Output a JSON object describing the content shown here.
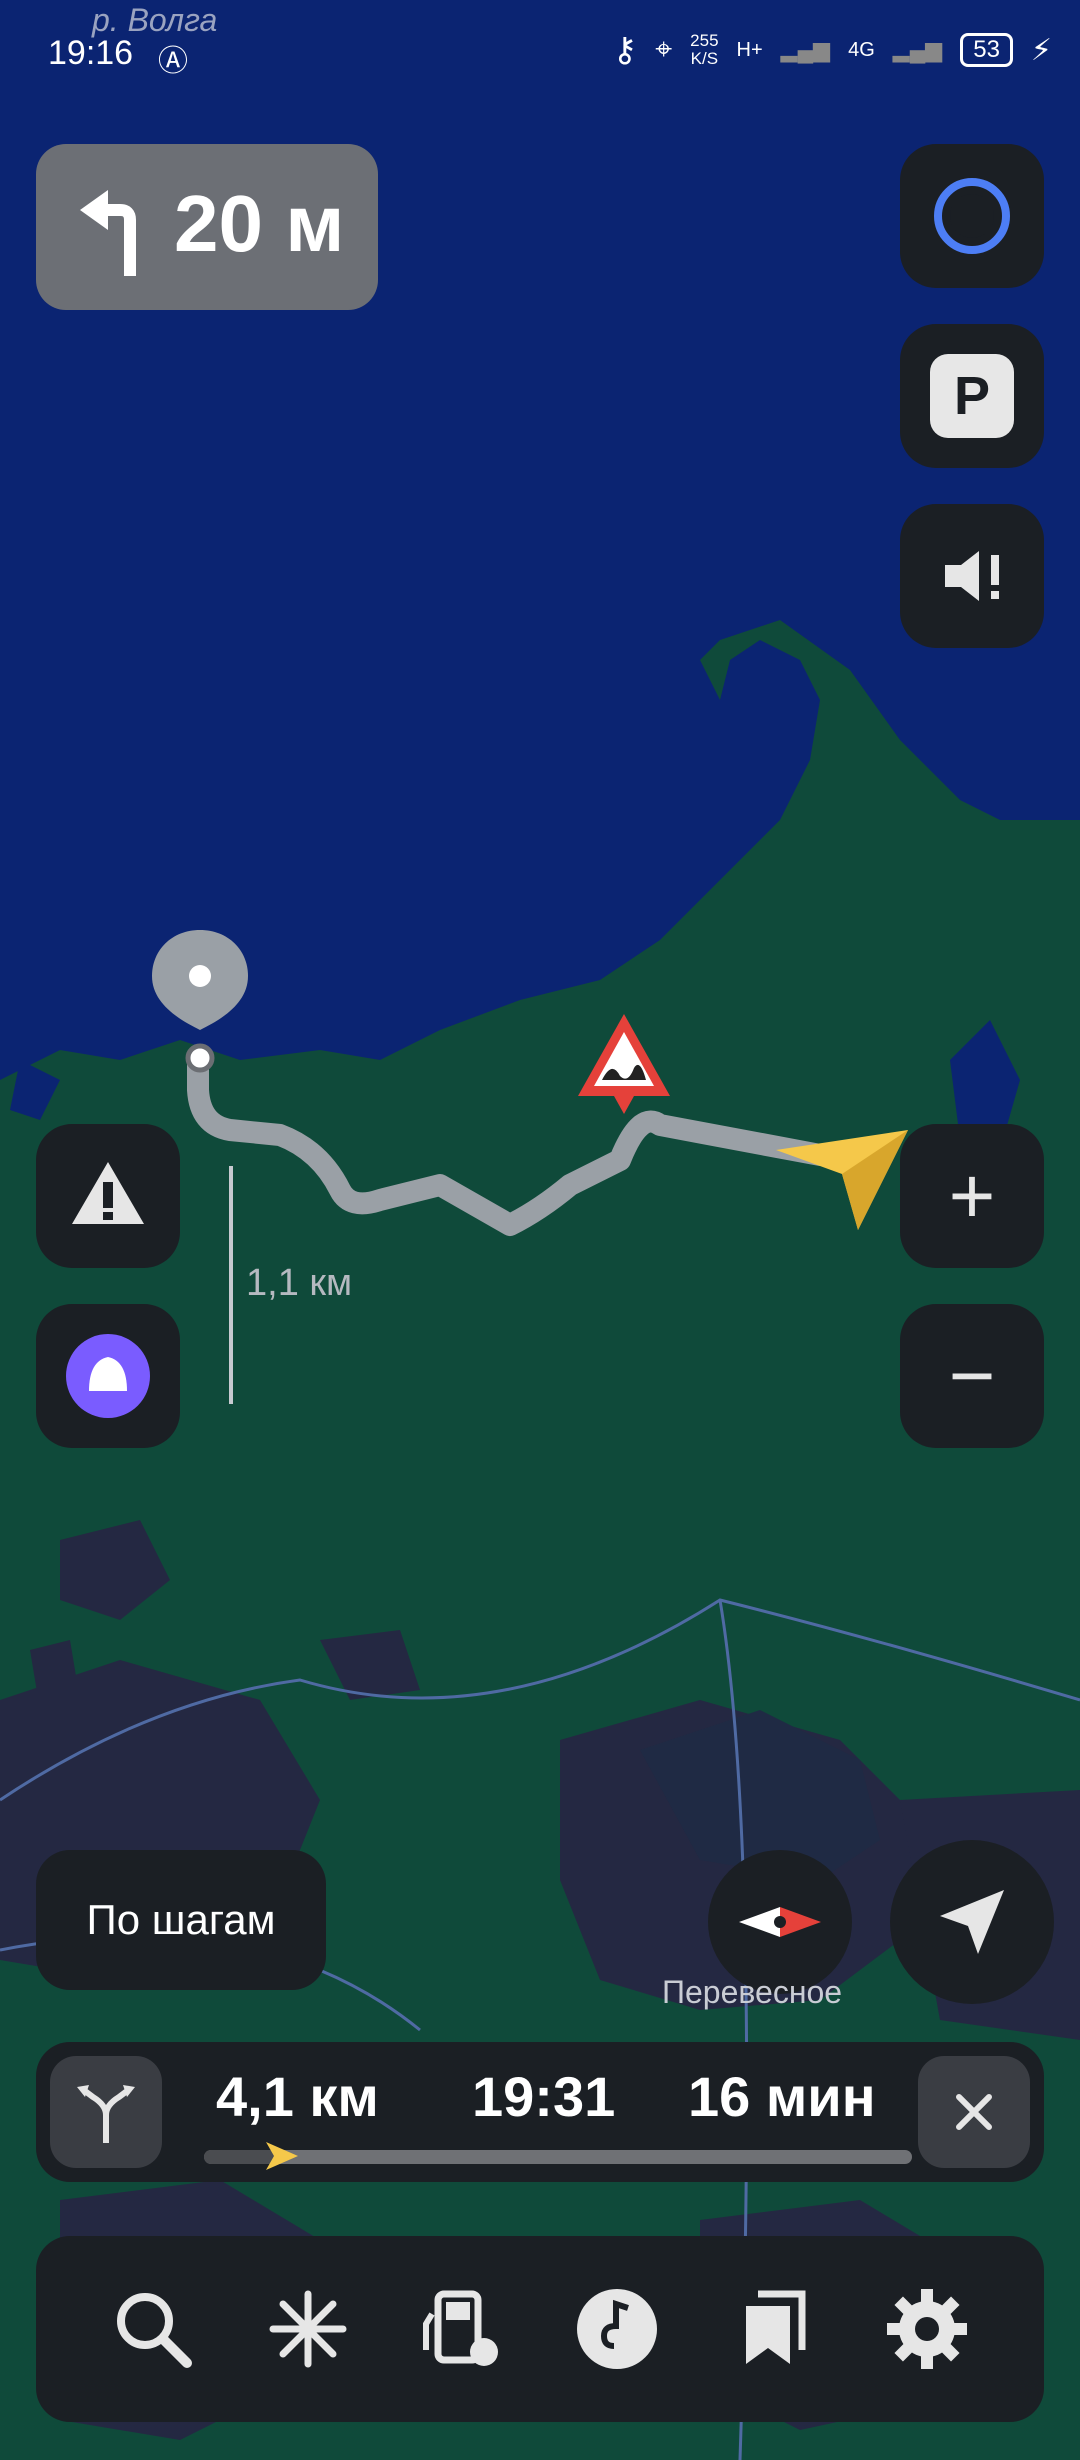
{
  "status": {
    "time": "19:16",
    "river_label": "р. Волга",
    "net_speed_value": "255",
    "net_speed_unit": "K/S",
    "network": "H+",
    "network_4g": "4G",
    "battery": "53"
  },
  "maneuver": {
    "icon": "turn-left-icon",
    "distance": "20 м"
  },
  "map": {
    "scale_label": "1,1 км",
    "place_label": "Перевесное",
    "water_color": "#0b2472",
    "land_color": "#0f4a3a",
    "route_color": "#9aa0a6",
    "cursor_color": "#f2c744"
  },
  "right_controls": [
    {
      "icon": "alice-ring-icon"
    },
    {
      "icon": "parking-icon",
      "label": "P"
    },
    {
      "icon": "speaker-alert-icon"
    }
  ],
  "left_controls": [
    {
      "icon": "road-event-icon"
    },
    {
      "icon": "alice-voice-icon"
    }
  ],
  "zoom": {
    "plus": "+",
    "minus": "−"
  },
  "steps_button": "По шагам",
  "route": {
    "distance": "4,1 км",
    "eta": "19:31",
    "duration": "16 мин",
    "progress_fraction": 0.11
  },
  "bottom_nav": [
    {
      "icon": "search-icon"
    },
    {
      "icon": "spark-icon"
    },
    {
      "icon": "fuel-icon"
    },
    {
      "icon": "music-icon"
    },
    {
      "icon": "bookmarks-icon"
    },
    {
      "icon": "settings-icon"
    }
  ]
}
